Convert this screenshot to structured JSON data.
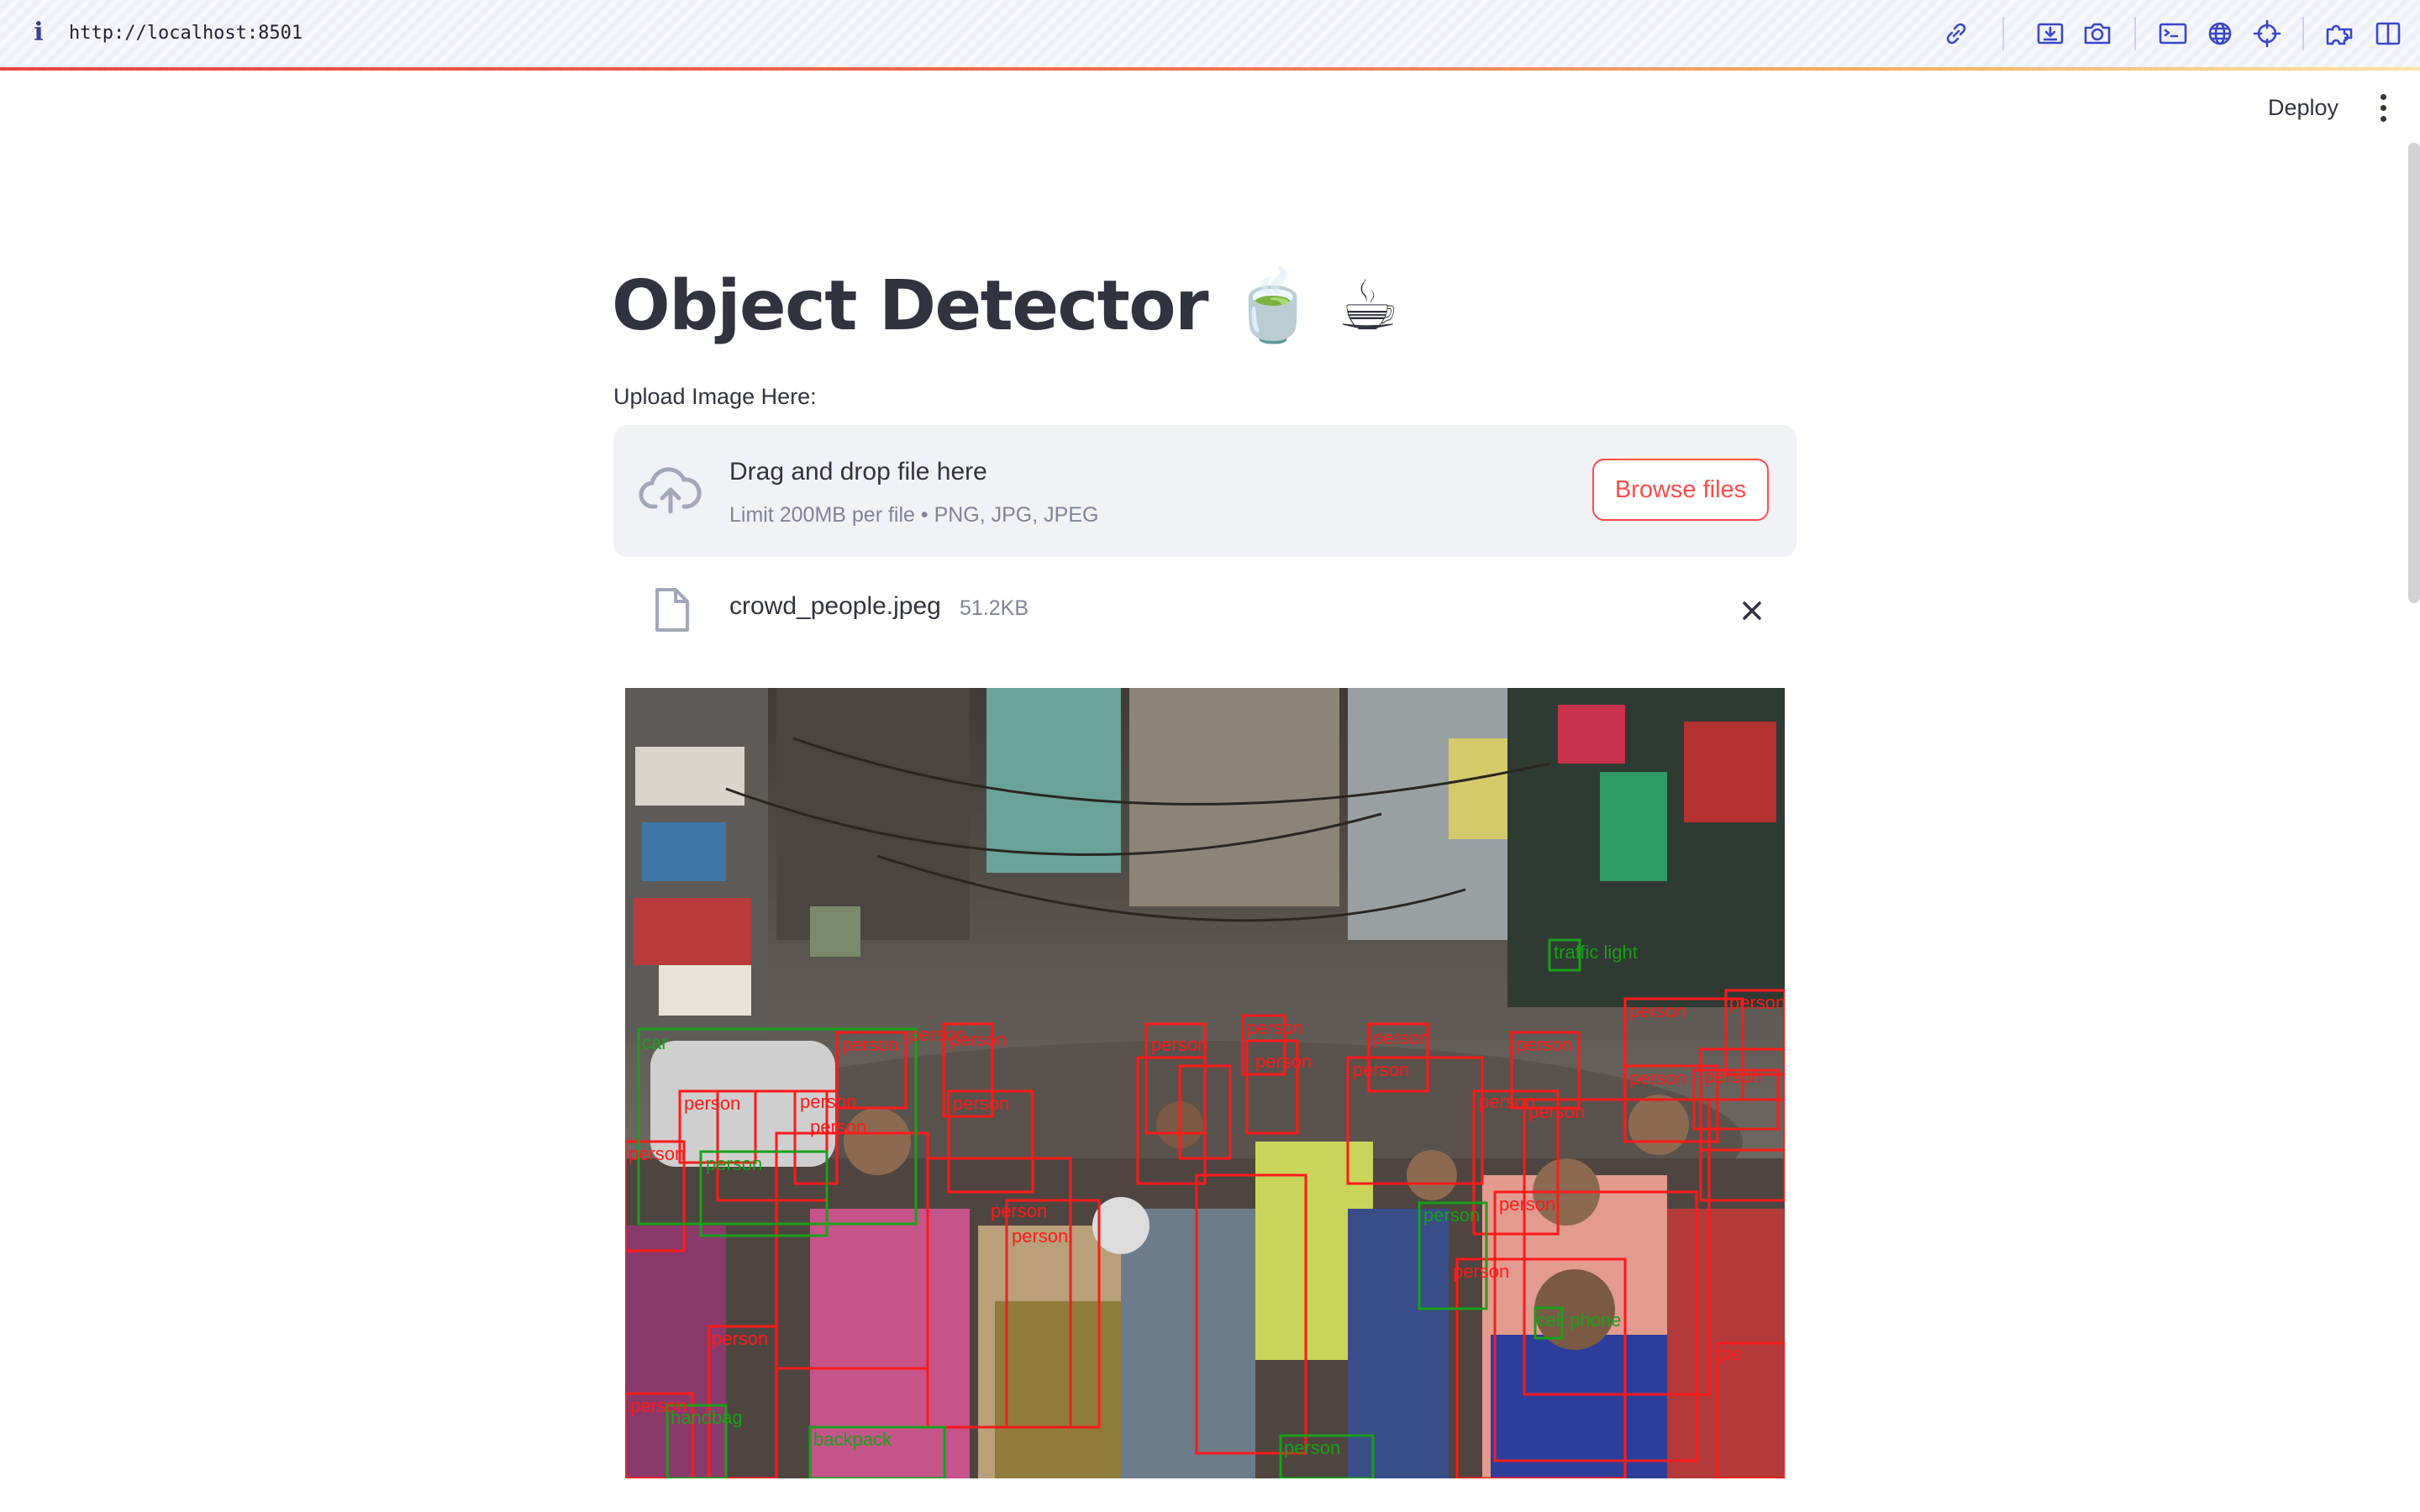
{
  "browser": {
    "url": "http://localhost:8501",
    "toolbar_icons": [
      "link-icon",
      "screenshot-download-icon",
      "camera-icon",
      "terminal-icon",
      "globe-icon",
      "crosshair-icon",
      "extension-icon",
      "split-view-icon"
    ]
  },
  "header": {
    "deploy_label": "Deploy",
    "menu_icon": "kebab-menu-icon"
  },
  "main": {
    "title": "Object Detector 🍵 ☕",
    "uploader": {
      "label": "Upload Image Here:",
      "drop_title": "Drag and drop file here",
      "drop_subtitle": "Limit 200MB per file • PNG, JPG, JPEG",
      "browse_label": "Browse files",
      "icon": "cloud-upload-icon"
    },
    "uploaded_file": {
      "name": "crowd_people.jpeg",
      "size": "51.2KB",
      "icon": "file-icon",
      "remove_icon": "close-icon"
    },
    "result_image": {
      "description_labels": [
        "person",
        "car",
        "traffic light",
        "backpack",
        "handbag",
        "cell phone"
      ],
      "colors": {
        "person": "#ff1a1a",
        "other": "#1aa01a"
      }
    }
  },
  "theme": {
    "accent": "#ff4b4b",
    "text": "#31333f",
    "muted": "#808495",
    "dropzone_bg": "#f0f2f6"
  }
}
